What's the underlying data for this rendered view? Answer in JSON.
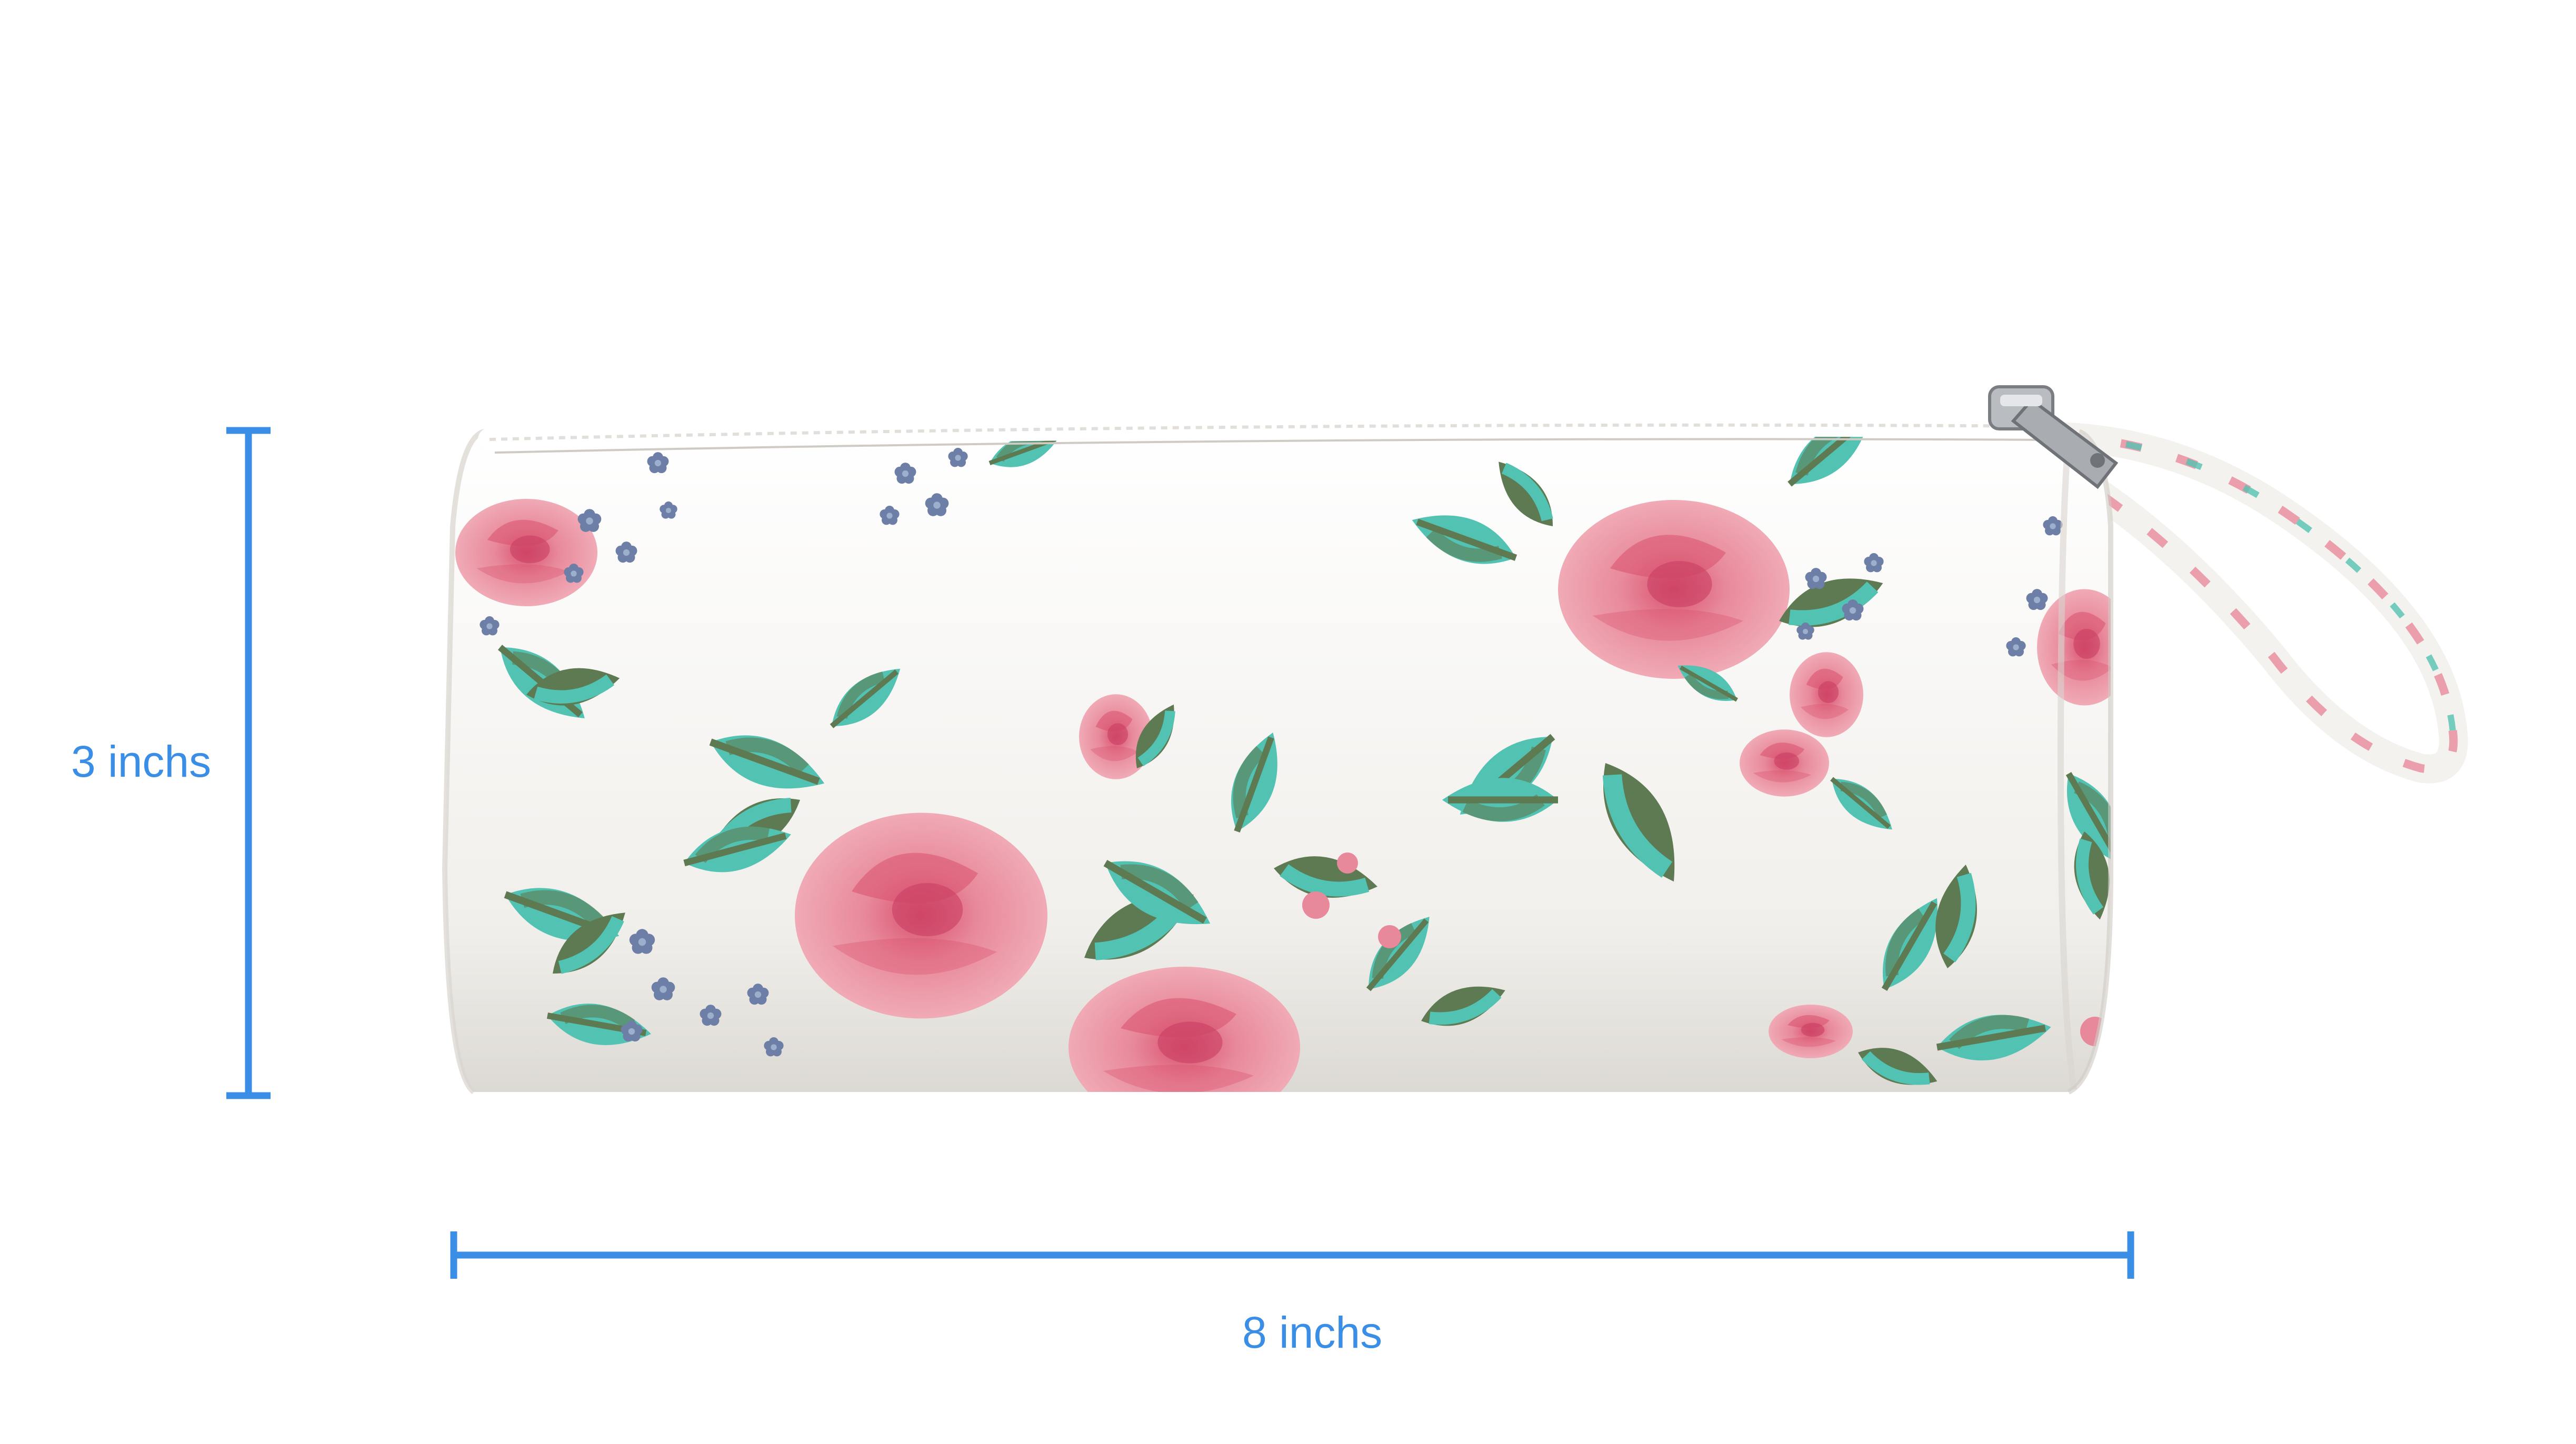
{
  "dimensions": {
    "height_label": "3 inchs",
    "width_label": "8 inchs",
    "color": "#3b8ee6"
  },
  "product": {
    "name_icon": "floral-pencil-pouch",
    "fabric_color": "#f4f2ee",
    "rose_color": "#e8899b",
    "rose_dark": "#d9506e",
    "leaf_color": "#52c2b2",
    "leaf_dark": "#5e7a52",
    "forget_me_not_color": "#6d7fa6"
  }
}
